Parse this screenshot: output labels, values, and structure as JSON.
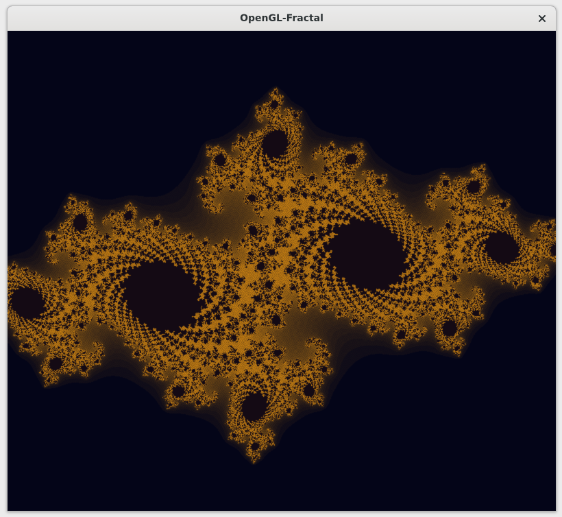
{
  "window": {
    "title": "OpenGL-Fractal",
    "close_icon": "close-icon"
  },
  "canvas": {
    "content": "julia-set-fractal",
    "background_color": "#05061a",
    "fractal_color": "#d98b12"
  }
}
